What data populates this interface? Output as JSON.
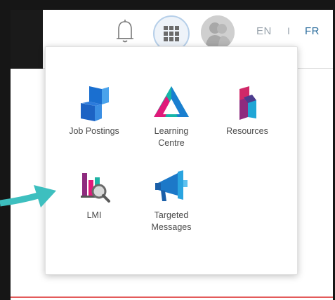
{
  "header": {
    "notifications_icon": "bell-icon",
    "apps_icon": "grid-icon",
    "profile_icon": "user-silhouette-icon",
    "lang_en": "EN",
    "lang_separator": "I",
    "lang_fr": "FR",
    "active_lang": "FR"
  },
  "apps_menu": {
    "items": [
      {
        "label_line1": "Job Postings",
        "label_line2": "",
        "icon": "job-postings-icon"
      },
      {
        "label_line1": "Learning",
        "label_line2": "Centre",
        "icon": "learning-centre-icon"
      },
      {
        "label_line1": "Resources",
        "label_line2": "",
        "icon": "resources-icon"
      },
      {
        "label_line1": "LMI",
        "label_line2": "",
        "icon": "lmi-icon"
      },
      {
        "label_line1": "Targeted",
        "label_line2": "Messages",
        "icon": "targeted-messages-icon"
      }
    ]
  },
  "colors": {
    "accent_blue": "#2e6f9e",
    "arrow_teal": "#3dbfbf",
    "bottom_rule": "#e35b5b"
  }
}
